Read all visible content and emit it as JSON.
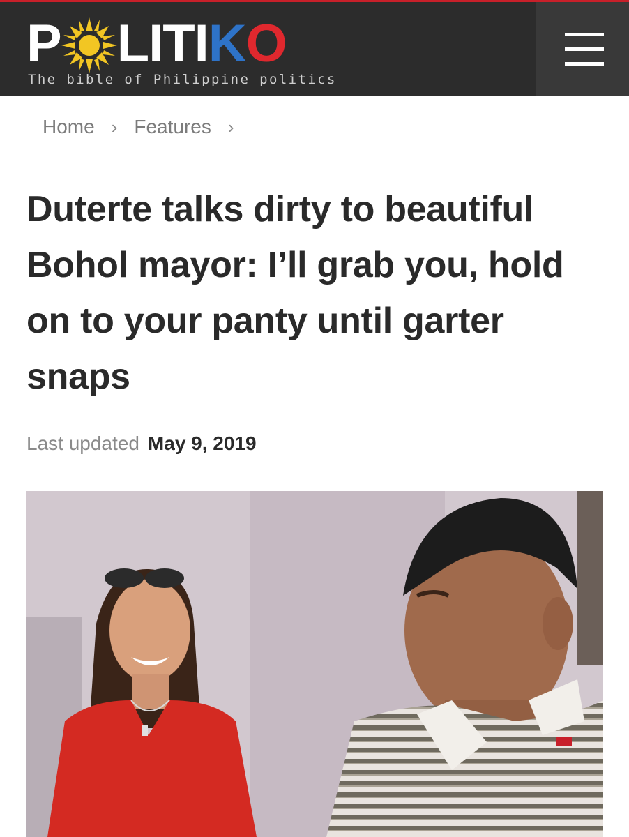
{
  "brand": {
    "logo_p": "P",
    "logo_litik": "LITI",
    "logo_k": "K",
    "logo_o": "O",
    "tagline": "The bible of Philippine politics",
    "colors": {
      "header_bg": "#2c2c2c",
      "k_blue": "#2e73c8",
      "o_red": "#e0282e",
      "sun_yellow": "#f2c623"
    }
  },
  "header": {
    "menu_icon": "hamburger-icon"
  },
  "breadcrumb": {
    "items": [
      "Home",
      "Features"
    ],
    "separator": "›"
  },
  "article": {
    "title": "Duterte talks dirty to beautiful Bohol mayor: I’ll grab you, hold on to your panty until garter snaps",
    "last_updated_label": "Last updated",
    "date": "May 9, 2019"
  }
}
